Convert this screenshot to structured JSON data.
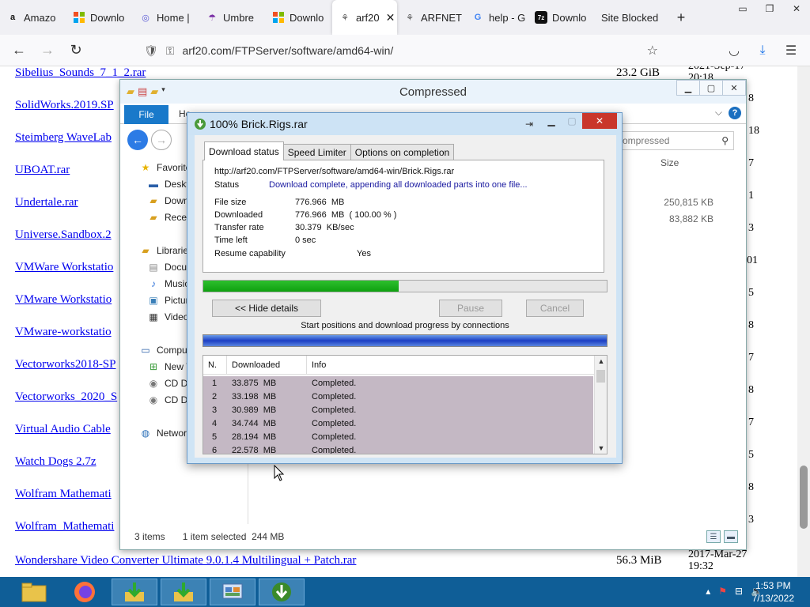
{
  "browser": {
    "tabs": [
      {
        "label": "Amazo",
        "icon": "amazon-icon"
      },
      {
        "label": "Downlo",
        "icon": "windows-icon"
      },
      {
        "label": "Home |",
        "icon": "home-icon"
      },
      {
        "label": "Umbre",
        "icon": "umbrella-icon"
      },
      {
        "label": "Downlo",
        "icon": "windows-icon"
      },
      {
        "label": "arf20",
        "icon": "network-icon"
      },
      {
        "label": "ARFNET",
        "icon": "network-icon"
      },
      {
        "label": "help - G",
        "icon": "google-icon"
      },
      {
        "label": "Downlo",
        "icon": "7zip-icon"
      },
      {
        "label": "Site Blocked",
        "icon": ""
      }
    ],
    "new_tab": "+",
    "url": "arf20.com/FTPServer/software/amd64-win/"
  },
  "page": {
    "files": [
      {
        "name": "Sibelius_Sounds_7_1_2.rar",
        "size": "23.2 GiB",
        "date": "2021-Sep-17 20:18"
      },
      {
        "name": "SolidWorks.2019.SP",
        "size": "",
        "date": "8"
      },
      {
        "name": "Steimberg WaveLab",
        "size": "",
        "date": "18"
      },
      {
        "name": "UBOAT.rar",
        "size": "",
        "date": "7"
      },
      {
        "name": "Undertale.rar",
        "size": "",
        "date": "1"
      },
      {
        "name": "Universe.Sandbox.2",
        "size": "",
        "date": "3"
      },
      {
        "name": "VMWare Workstatio",
        "size": "",
        "date": "01"
      },
      {
        "name": "VMware Workstatio",
        "size": "",
        "date": "5"
      },
      {
        "name": "VMware-workstatio",
        "size": "",
        "date": "8"
      },
      {
        "name": "Vectorworks2018-SP",
        "size": "",
        "date": "7"
      },
      {
        "name": "Vectorworks_2020_S",
        "size": "",
        "date": "8"
      },
      {
        "name": "Virtual Audio Cable",
        "size": "",
        "date": "7"
      },
      {
        "name": "Watch Dogs 2.7z",
        "size": "",
        "date": "5"
      },
      {
        "name": "Wolfram Mathemati",
        "size": "",
        "date": "8"
      },
      {
        "name": "Wolfram_Mathemati",
        "size": "",
        "date": "3"
      },
      {
        "name": "Wondershare Video Converter Ultimate 9.0.1.4 Multilingual + Patch.rar",
        "size": "56.3 MiB",
        "date": "2017-Mar-27 19:32"
      }
    ]
  },
  "explorer": {
    "title": "Compressed",
    "ribbon_file": "File",
    "ribbon_home": "Ho",
    "search_placeholder": "ompressed",
    "column_size": "Size",
    "sizes": [
      "250,815 KB",
      "83,882 KB"
    ],
    "tree": [
      {
        "label": "Favorite",
        "icon": "star-icon"
      },
      {
        "label": "Deskt",
        "icon": "desktop-icon"
      },
      {
        "label": "Down",
        "icon": "downloads-icon"
      },
      {
        "label": "Recen",
        "icon": "recent-icon"
      },
      {
        "label": "Librarie",
        "icon": "library-icon"
      },
      {
        "label": "Docu",
        "icon": "documents-icon"
      },
      {
        "label": "Music",
        "icon": "music-icon"
      },
      {
        "label": "Pictur",
        "icon": "pictures-icon"
      },
      {
        "label": "Video",
        "icon": "videos-icon"
      },
      {
        "label": "Compu",
        "icon": "computer-icon"
      },
      {
        "label": "New V",
        "icon": "drive-icon"
      },
      {
        "label": "CD Dr",
        "icon": "cd-drive-icon"
      },
      {
        "label": "CD Dr",
        "icon": "cd-drive-icon"
      },
      {
        "label": "Networ",
        "icon": "network-icon"
      }
    ],
    "status_items": "3 items",
    "status_selected": "1 item selected  244 MB"
  },
  "idm": {
    "title": "100% Brick.Rigs.rar",
    "tabs": [
      "Download status",
      "Speed Limiter",
      "Options on completion"
    ],
    "url": "http://arf20.com/FTPServer/software/amd64-win/Brick.Rigs.rar",
    "status_label": "Status",
    "status_value": "Download complete, appending all downloaded parts into one file...",
    "file_size_label": "File size",
    "file_size_value": "776.966  MB",
    "downloaded_label": "Downloaded",
    "downloaded_value": "776.966  MB  ( 100.00 % )",
    "rate_label": "Transfer rate",
    "rate_value": "30.379  KB/sec",
    "time_label": "Time left",
    "time_value": "0 sec",
    "resume_label": "Resume capability",
    "resume_value": "Yes",
    "progress_bar_fraction": 0.485,
    "hide_details": "<< Hide details",
    "pause": "Pause",
    "cancel": "Cancel",
    "conn_caption": "Start positions and download progress by connections",
    "conn_headers": [
      "N.",
      "Downloaded",
      "Info"
    ],
    "connections": [
      {
        "n": "1",
        "downloaded": "33.875  MB",
        "info": "Completed."
      },
      {
        "n": "2",
        "downloaded": "33.198  MB",
        "info": "Completed."
      },
      {
        "n": "3",
        "downloaded": "30.989  MB",
        "info": "Completed."
      },
      {
        "n": "4",
        "downloaded": "34.744  MB",
        "info": "Completed."
      },
      {
        "n": "5",
        "downloaded": "28.194  MB",
        "info": "Completed."
      },
      {
        "n": "6",
        "downloaded": "22.578  MB",
        "info": "Completed."
      }
    ]
  },
  "taskbar": {
    "time": "1:53 PM",
    "date": "7/13/2022"
  },
  "colors": {
    "link": "#0000ee",
    "taskbar": "#0f5e97",
    "idm_progress": "#16a816",
    "idm_close": "#c9362b"
  }
}
